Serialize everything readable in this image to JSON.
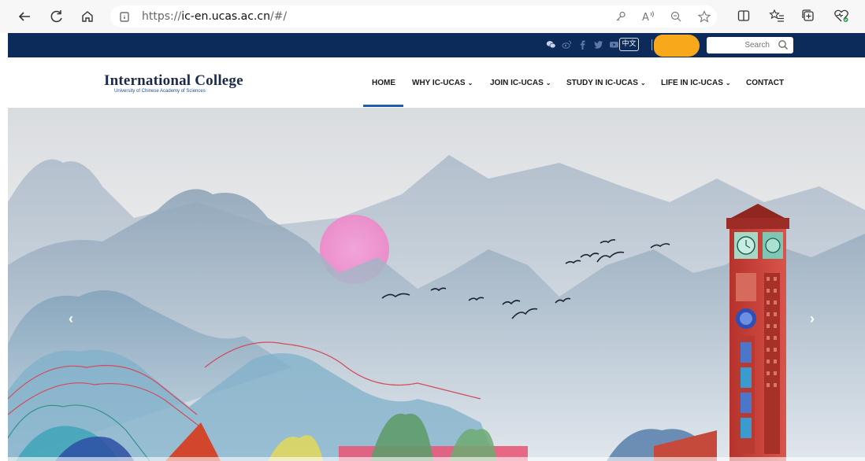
{
  "browser": {
    "url_prefix": "https://",
    "url_host": "ic-en.ucas.ac.cn",
    "url_path": "/#/",
    "icons": [
      "back-icon",
      "refresh-icon",
      "home-icon",
      "site-info-icon",
      "key-icon",
      "read-aloud-icon",
      "zoom-icon",
      "favorite-icon",
      "split-screen-icon",
      "favorites-icon",
      "collections-icon",
      "browser-essentials-icon"
    ]
  },
  "topbar": {
    "social_icons": [
      "wechat-icon",
      "weibo-icon",
      "facebook-icon",
      "twitter-icon",
      "youtube-icon"
    ],
    "lang_label": "中文",
    "search_placeholder": "Search",
    "bg_color": "#0c2a5a"
  },
  "header": {
    "logo_title": "International College",
    "logo_subtitle": "University of Chinese Academy of Sciences",
    "nav": [
      {
        "label": "HOME",
        "active": true,
        "dropdown": false
      },
      {
        "label": "WHY IC-UCAS",
        "active": false,
        "dropdown": true
      },
      {
        "label": "JOIN IC-UCAS",
        "active": false,
        "dropdown": true
      },
      {
        "label": "STUDY IN IC-UCAS",
        "active": false,
        "dropdown": true
      },
      {
        "label": "LIFE IN IC-UCAS",
        "active": false,
        "dropdown": true
      },
      {
        "label": "CONTACT",
        "active": false,
        "dropdown": false
      }
    ],
    "chevron": "⌄",
    "accent_color": "#1a5fb4"
  },
  "hero": {
    "prev_arrow": "‹",
    "next_arrow": "›"
  }
}
